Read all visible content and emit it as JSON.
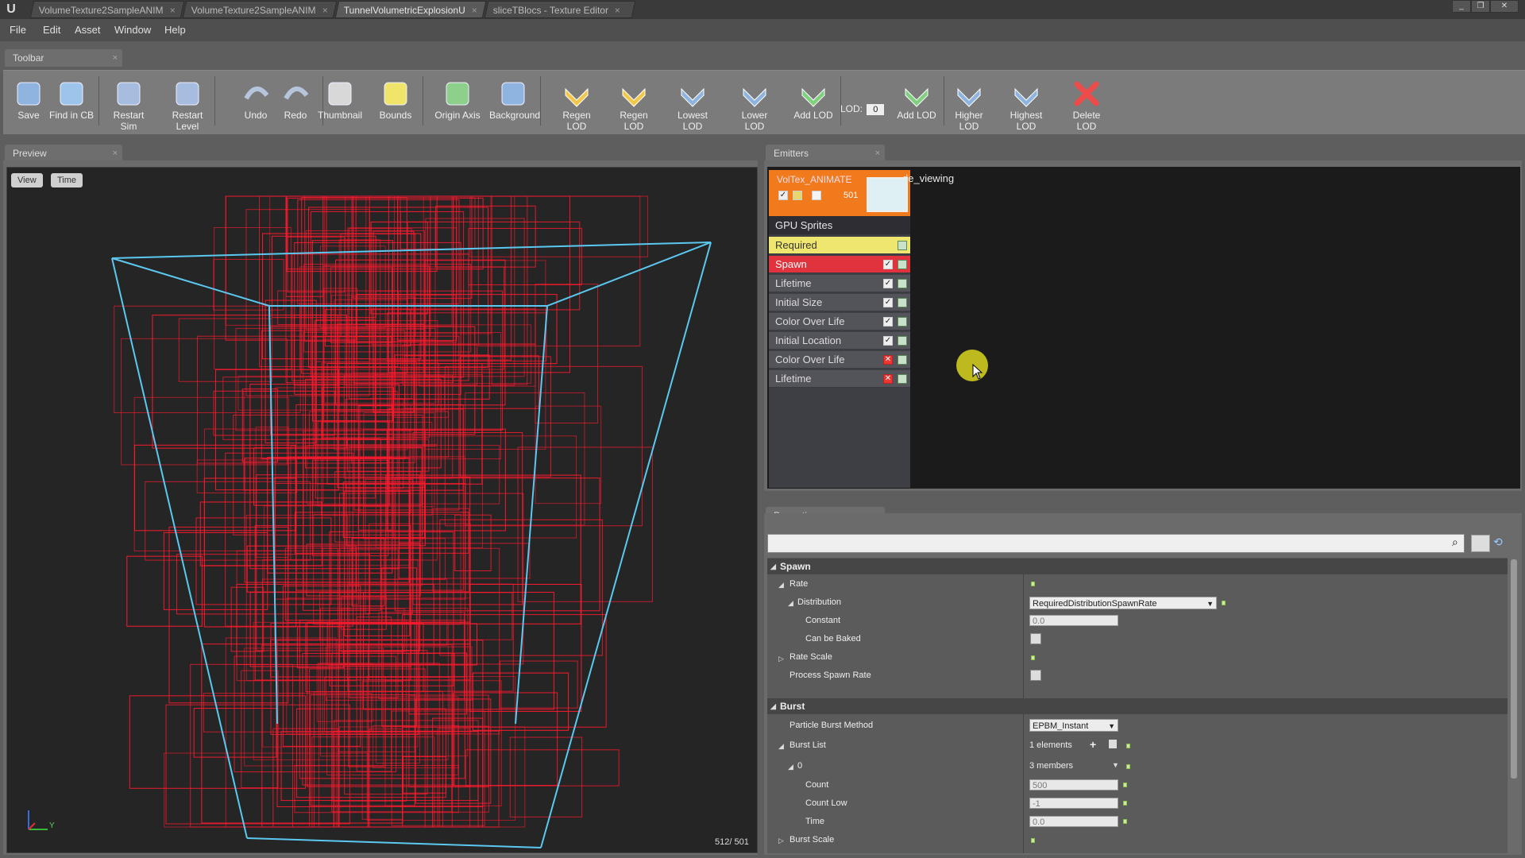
{
  "tabs": [
    {
      "label": "VolumeTexture2SampleANIM",
      "active": false
    },
    {
      "label": "VolumeTexture2SampleANIM",
      "active": false
    },
    {
      "label": "TunnelVolumetricExplosionU",
      "active": true
    },
    {
      "label": "sliceTBlocs - Texture Editor",
      "active": false
    }
  ],
  "menu": [
    "File",
    "Edit",
    "Asset",
    "Window",
    "Help"
  ],
  "toolbar": {
    "title": "Toolbar",
    "buttons": [
      {
        "label": "Save",
        "icon": "save-icon"
      },
      {
        "label": "Find in CB",
        "icon": "find-icon"
      },
      {
        "label": "Restart Sim",
        "icon": "restart-sim-icon"
      },
      {
        "label": "Restart Level",
        "icon": "restart-level-icon"
      },
      {
        "label": "Undo",
        "icon": "undo-icon"
      },
      {
        "label": "Redo",
        "icon": "redo-icon"
      },
      {
        "label": "Thumbnail",
        "icon": "thumbnail-icon"
      },
      {
        "label": "Bounds",
        "icon": "bounds-icon"
      },
      {
        "label": "Origin Axis",
        "icon": "origin-axis-icon"
      },
      {
        "label": "Background",
        "icon": "background-icon"
      },
      {
        "label": "Regen LOD",
        "icon": "regen-lod-icon"
      },
      {
        "label": "Regen LOD",
        "icon": "regen-lod-icon"
      },
      {
        "label": "Lowest LOD",
        "icon": "lowest-lod-icon"
      },
      {
        "label": "Lower LOD",
        "icon": "lower-lod-icon"
      },
      {
        "label": "Add LOD",
        "icon": "add-lod-icon"
      },
      {
        "label": "Add LOD",
        "icon": "add-lod-icon"
      },
      {
        "label": "Higher LOD",
        "icon": "higher-lod-icon"
      },
      {
        "label": "Highest LOD",
        "icon": "highest-lod-icon"
      },
      {
        "label": "Delete LOD",
        "icon": "delete-lod-icon"
      }
    ],
    "lod_label": "LOD:",
    "lod_value": "0"
  },
  "preview": {
    "title": "Preview",
    "view_button": "View",
    "time_button": "Time",
    "counter": "512/ 501",
    "axis_y": "Y"
  },
  "emitters": {
    "title": "Emitters",
    "emitter_name": "VolTex_ANIMATE",
    "emitter_suffix": "de_viewing",
    "emitter_count": "501",
    "type_label": "GPU Sprites",
    "modules": [
      {
        "label": "Required",
        "style": "required",
        "enabled": null
      },
      {
        "label": "Spawn",
        "style": "spawn",
        "enabled": true
      },
      {
        "label": "Lifetime",
        "style": "normal",
        "enabled": true
      },
      {
        "label": "Initial Size",
        "style": "normal",
        "enabled": true
      },
      {
        "label": "Color Over Life",
        "style": "normal",
        "enabled": true
      },
      {
        "label": "Initial Location",
        "style": "normal",
        "enabled": true
      },
      {
        "label": "Color Over Life",
        "style": "normal",
        "enabled": false
      },
      {
        "label": "Lifetime",
        "style": "normal",
        "enabled": false
      }
    ]
  },
  "properties": {
    "title": "Properties",
    "spawn_section": "Spawn",
    "rate": "Rate",
    "distribution": "Distribution",
    "distribution_value": "RequiredDistributionSpawnRate",
    "constant": "Constant",
    "constant_value": "0.0",
    "can_be_baked": "Can be Baked",
    "rate_scale": "Rate Scale",
    "process_spawn_rate": "Process Spawn Rate",
    "burst_section": "Burst",
    "particle_burst_method": "Particle Burst Method",
    "particle_burst_method_value": "EPBM_Instant",
    "burst_list": "Burst List",
    "burst_list_value": "1 elements",
    "item_index": "0",
    "item_members": "3 members",
    "count": "Count",
    "count_value": "500",
    "count_low": "Count Low",
    "count_low_value": "-1",
    "time": "Time",
    "time_value": "0.0",
    "burst_scale": "Burst Scale"
  },
  "colors": {
    "particle": "#ff1a2e",
    "bounds": "#5bc8f0",
    "emitter_header": "#f07a1c",
    "required": "#efe670",
    "spawn": "#e0333d"
  }
}
